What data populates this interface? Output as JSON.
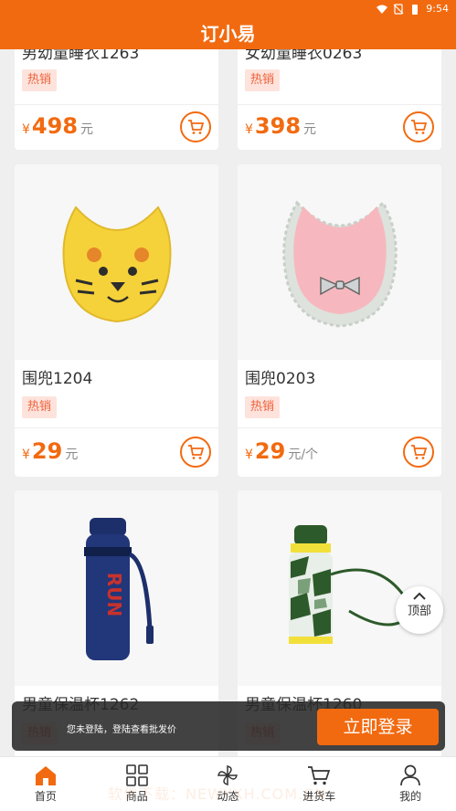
{
  "status": {
    "time": "9:54"
  },
  "header": {
    "title": "订小易"
  },
  "products": [
    {
      "name": "男幼童睡衣1263",
      "tag": "热销",
      "currency": "¥",
      "price": "498",
      "unit": "元"
    },
    {
      "name": "女幼童睡衣0263",
      "tag": "热销",
      "currency": "¥",
      "price": "398",
      "unit": "元"
    },
    {
      "name": "围兜1204",
      "tag": "热销",
      "currency": "¥",
      "price": "29",
      "unit": "元"
    },
    {
      "name": "围兜0203",
      "tag": "热销",
      "currency": "¥",
      "price": "29",
      "unit": "元/个"
    },
    {
      "name": "男童保温杯1262",
      "tag": "热销"
    },
    {
      "name": "男童保温杯1260",
      "tag": "热销"
    }
  ],
  "top_button": {
    "label": "顶部"
  },
  "login_bar": {
    "message": "您未登陆，登陆查看批发价",
    "button": "立即登录"
  },
  "tabs": [
    {
      "label": "首页",
      "icon": "home-icon"
    },
    {
      "label": "商品",
      "icon": "grid-icon"
    },
    {
      "label": "动态",
      "icon": "pinwheel-icon"
    },
    {
      "label": "进货车",
      "icon": "cart-icon"
    },
    {
      "label": "我的",
      "icon": "user-icon"
    }
  ],
  "watermark": "软件下载：NEWYXH.COM.CN",
  "colors": {
    "accent": "#f26a10",
    "tag_bg": "#fde3dc",
    "tag_text": "#f0603a"
  }
}
